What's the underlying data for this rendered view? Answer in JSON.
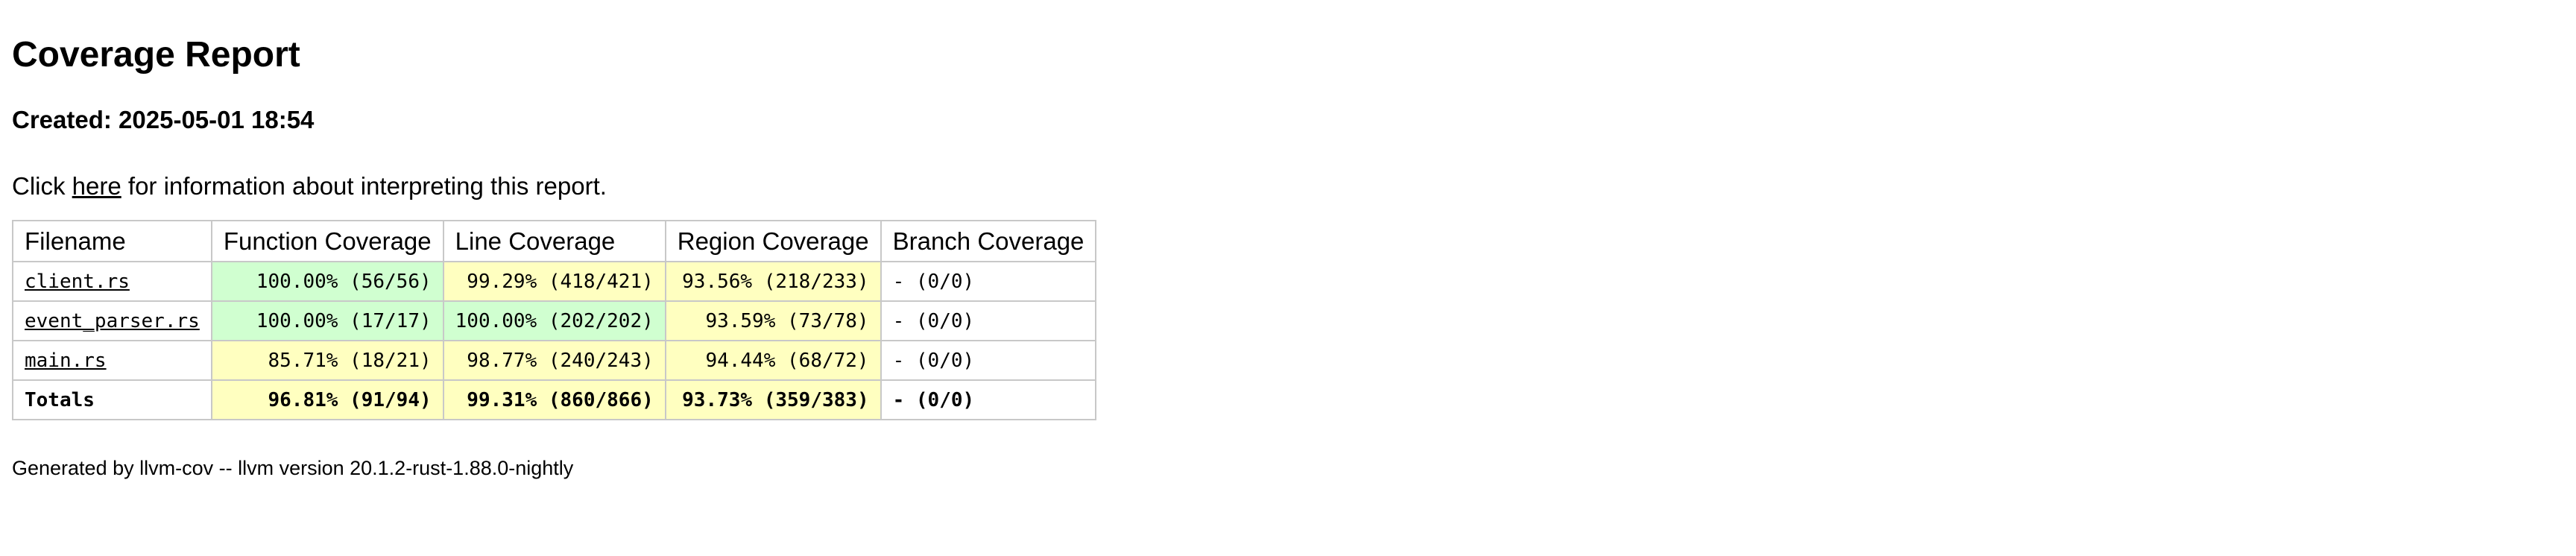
{
  "title": "Coverage Report",
  "created": "Created: 2025-05-01 18:54",
  "intro": {
    "before": "Click ",
    "link": "here",
    "after": " for information about interpreting this report."
  },
  "columns": [
    "Filename",
    "Function Coverage",
    "Line Coverage",
    "Region Coverage",
    "Branch Coverage"
  ],
  "rows": [
    {
      "file": "client.rs",
      "function": "100.00% (56/56)",
      "line": "99.29% (418/421)",
      "region": "93.56% (218/233)",
      "branch": "- (0/0)"
    },
    {
      "file": "event_parser.rs",
      "function": "100.00% (17/17)",
      "line": "100.00% (202/202)",
      "region": "93.59% (73/78)",
      "branch": "- (0/0)"
    },
    {
      "file": "main.rs",
      "function": "85.71% (18/21)",
      "line": "98.77% (240/243)",
      "region": "94.44% (68/72)",
      "branch": "- (0/0)"
    }
  ],
  "totals": {
    "label": "Totals",
    "function": "96.81% (91/94)",
    "line": "99.31% (860/866)",
    "region": "93.73% (359/383)",
    "branch": "- (0/0)"
  },
  "colors": {
    "full_coverage": "#d0ffd0",
    "partial_coverage": "#ffffc0",
    "border": "#c8c8c8"
  },
  "footer": "Generated by llvm-cov -- llvm version 20.1.2-rust-1.88.0-nightly"
}
